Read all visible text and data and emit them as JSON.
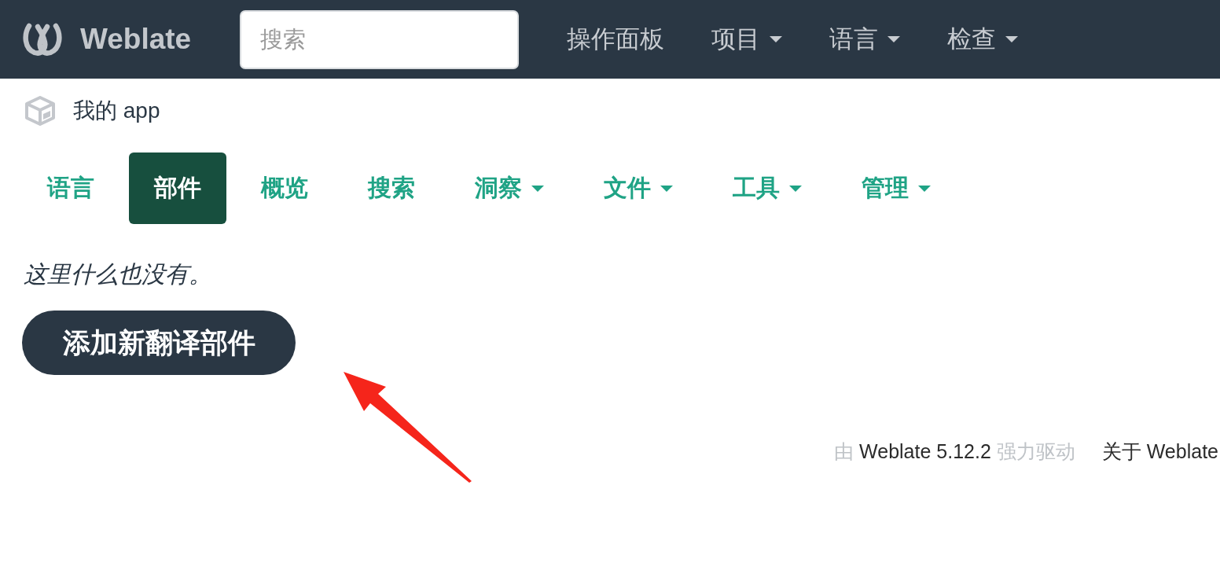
{
  "header": {
    "brand": "Weblate",
    "search": {
      "placeholder": "搜索"
    },
    "nav": [
      {
        "label": "操作面板",
        "dropdown": false
      },
      {
        "label": "项目",
        "dropdown": true
      },
      {
        "label": "语言",
        "dropdown": true
      },
      {
        "label": "检查",
        "dropdown": true
      }
    ]
  },
  "breadcrumb": {
    "label": "我的 app"
  },
  "tabs": [
    {
      "label": "语言",
      "selected": false,
      "dropdown": false
    },
    {
      "label": "部件",
      "selected": true,
      "dropdown": false
    },
    {
      "label": "概览",
      "selected": false,
      "dropdown": false
    },
    {
      "label": "搜索",
      "selected": false,
      "dropdown": false
    },
    {
      "label": "洞察",
      "selected": false,
      "dropdown": true
    },
    {
      "label": "文件",
      "selected": false,
      "dropdown": true
    },
    {
      "label": "工具",
      "selected": false,
      "dropdown": true
    },
    {
      "label": "管理",
      "selected": false,
      "dropdown": true
    }
  ],
  "empty_message": "这里什么也没有。",
  "add_button": "添加新翻译部件",
  "footer": {
    "powered_prefix": "由",
    "powered_link": "Weblate 5.12.2",
    "powered_suffix": "强力驱动",
    "about_link": "关于 Weblate"
  }
}
